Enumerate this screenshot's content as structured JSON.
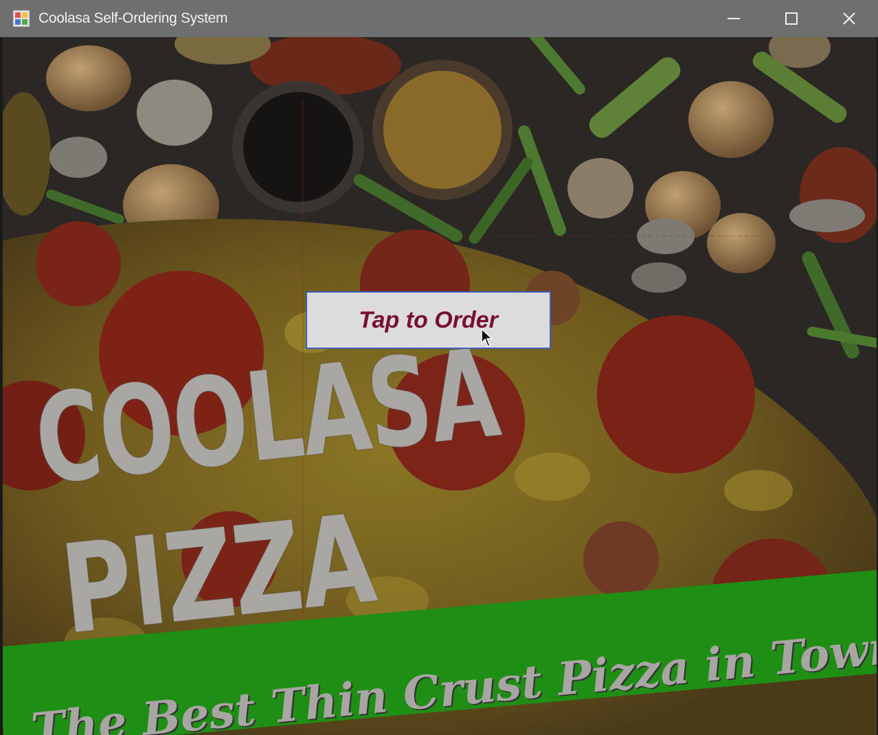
{
  "window": {
    "title": "Coolasa Self-Ordering System",
    "icon": "app-icon",
    "controls": [
      "minimize-icon",
      "maximize-icon",
      "close-icon"
    ]
  },
  "splash": {
    "order_button_label": "Tap to Order",
    "brand_line1": "COOLASA",
    "brand_line2": "PIZZA",
    "tagline": "The Best Thin Crust Pizza in Town"
  },
  "colors": {
    "titlebar": "#6f6f6f",
    "button_text": "#7a1030",
    "button_border": "#3d5fbf",
    "banner": "#1e8f14"
  }
}
